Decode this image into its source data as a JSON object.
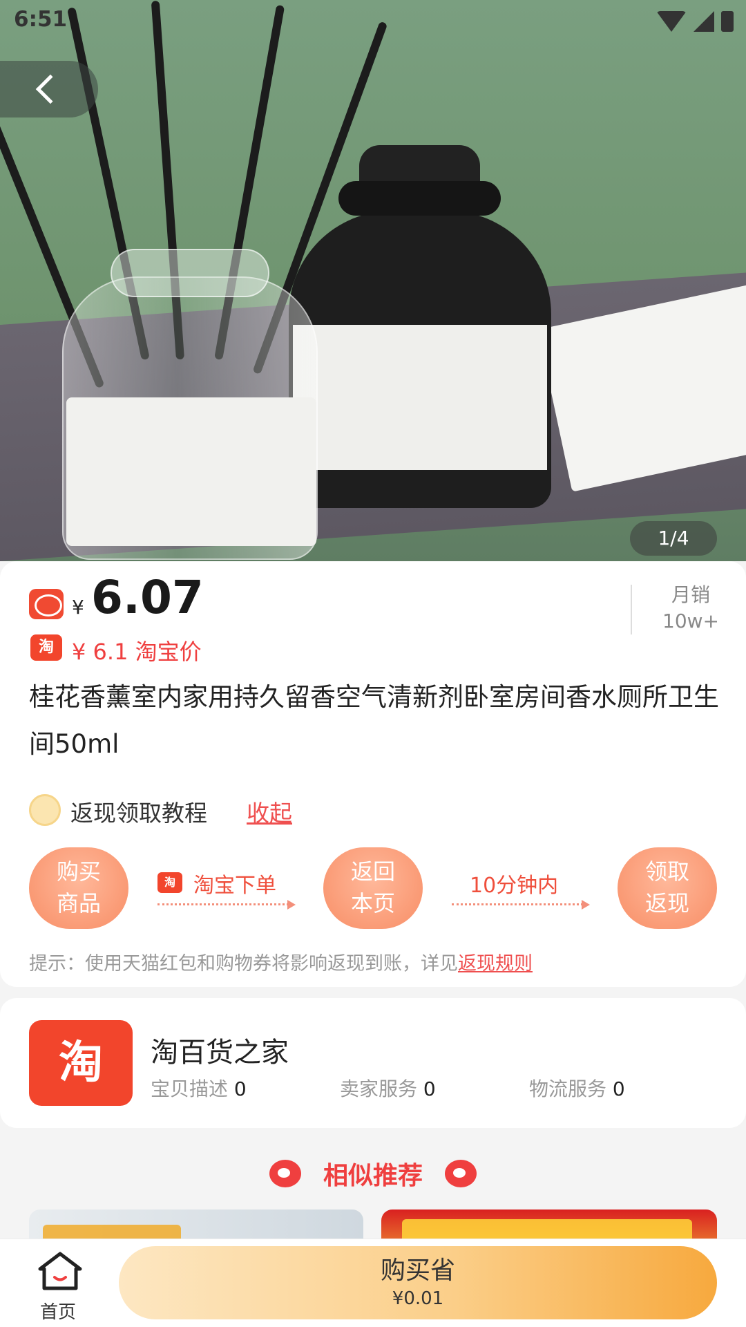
{
  "status_bar": {
    "time": "6:51"
  },
  "gallery": {
    "counter": "1/4"
  },
  "product": {
    "price_currency": "¥",
    "price": "6.07",
    "taobao_price": "¥ 6.1 淘宝价",
    "taobao_badge": "淘",
    "monthly_sales_label": "月销",
    "monthly_sales_value": "10w+",
    "title": "桂花香薰室内家用持久留香空气清新剂卧室房间香水厕所卫生间50ml"
  },
  "cashback": {
    "tutorial_label": "返现领取教程",
    "collapse_link": "收起",
    "steps": [
      {
        "line1": "购买",
        "line2": "商品"
      },
      {
        "line1": "返回",
        "line2": "本页"
      },
      {
        "line1": "领取",
        "line2": "返现"
      }
    ],
    "connector_1": "淘宝下单",
    "connector_2": "10分钟内",
    "tip_prefix": "提示：使用天猫红包和购物券将影响返现到账，详见",
    "tip_link": "返现规则"
  },
  "shop": {
    "logo_text": "淘",
    "name": "淘百货之家",
    "desc_label": "宝贝描述",
    "desc_score": "0",
    "service_label": "卖家服务",
    "service_score": "0",
    "logistics_label": "物流服务",
    "logistics_score": "0"
  },
  "recommend": {
    "title": "相似推荐"
  },
  "bottom_bar": {
    "home_label": "首页",
    "buy_label": "购买省",
    "buy_save": "¥0.01"
  },
  "colors": {
    "accent_red": "#ef3f3f",
    "taobao_orange": "#f2452c",
    "buy_gradient_end": "#f7a93e"
  }
}
